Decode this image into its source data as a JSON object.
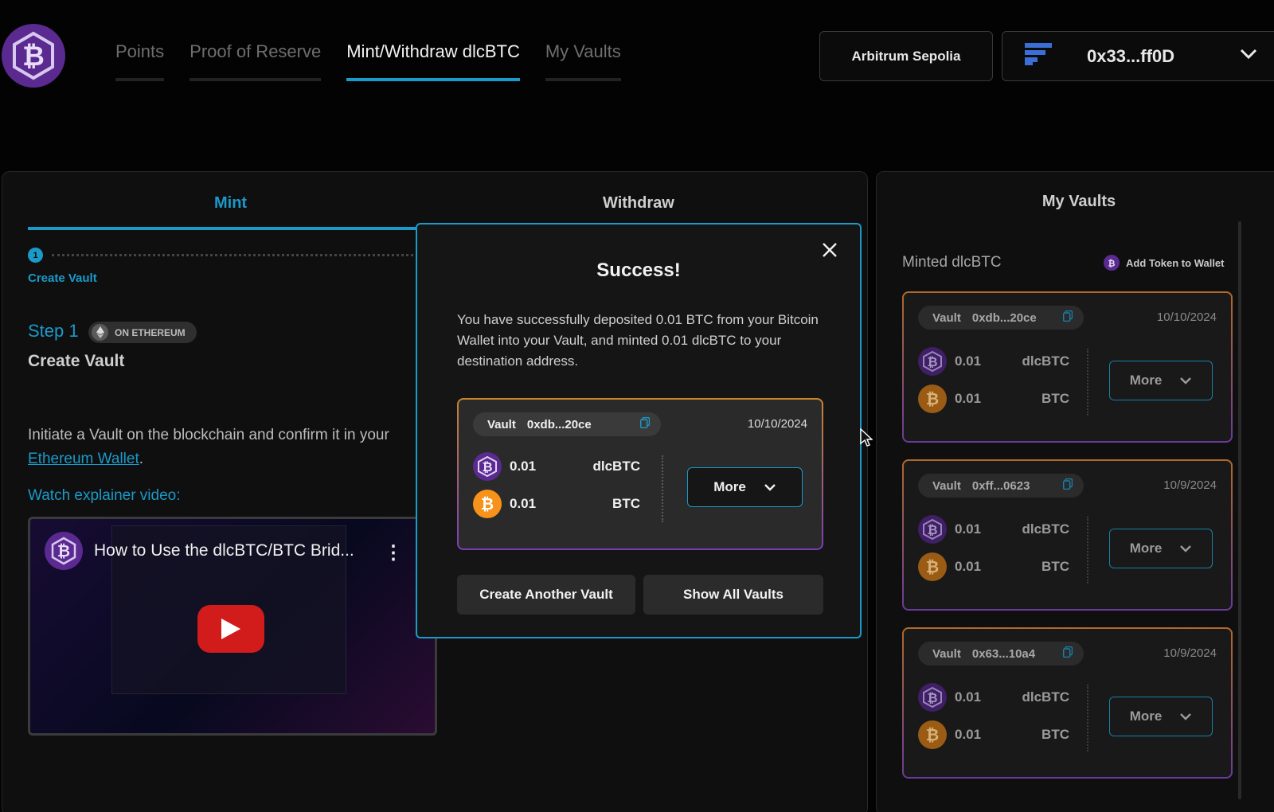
{
  "header": {
    "nav": [
      {
        "label": "Points"
      },
      {
        "label": "Proof of Reserve"
      },
      {
        "label": "Mint/Withdraw dlcBTC"
      },
      {
        "label": "My Vaults"
      }
    ],
    "active_nav": "Mint/Withdraw dlcBTC",
    "network": "Arbitrum Sepolia",
    "wallet_address": "0x33...ff0D"
  },
  "mint_panel": {
    "tabs": {
      "mint": "Mint",
      "withdraw": "Withdraw"
    },
    "stepper": {
      "number": "1",
      "label": "Create Vault"
    },
    "step_title": "Step 1",
    "step_badge": "ON ETHEREUM",
    "heading": "Create Vault",
    "description_prefix": "Initiate a Vault on the blockchain and confirm it in your ",
    "description_link": "Ethereum Wallet",
    "description_suffix": ".",
    "video_label": "Watch explainer video:",
    "video_title": "How to Use the dlcBTC/BTC Brid..."
  },
  "my_vaults": {
    "title": "My Vaults",
    "minted_label": "Minted dlcBTC",
    "add_token": "Add Token to Wallet",
    "vaults": [
      {
        "vault_label": "Vault",
        "id": "0xdb...20ce",
        "date": "10/10/2024",
        "dlc_amount": "0.01",
        "dlc_symbol": "dlcBTC",
        "btc_amount": "0.01",
        "btc_symbol": "BTC",
        "more": "More"
      },
      {
        "vault_label": "Vault",
        "id": "0xff...0623",
        "date": "10/9/2024",
        "dlc_amount": "0.01",
        "dlc_symbol": "dlcBTC",
        "btc_amount": "0.01",
        "btc_symbol": "BTC",
        "more": "More"
      },
      {
        "vault_label": "Vault",
        "id": "0x63...10a4",
        "date": "10/9/2024",
        "dlc_amount": "0.01",
        "dlc_symbol": "dlcBTC",
        "btc_amount": "0.01",
        "btc_symbol": "BTC",
        "more": "More"
      }
    ]
  },
  "modal": {
    "title": "Success!",
    "description": "You have successfully deposited 0.01 BTC from your Bitcoin Wallet into your Vault, and minted 0.01 dlcBTC to your destination address.",
    "vault": {
      "vault_label": "Vault",
      "id": "0xdb...20ce",
      "date": "10/10/2024",
      "dlc_amount": "0.01",
      "dlc_symbol": "dlcBTC",
      "btc_amount": "0.01",
      "btc_symbol": "BTC",
      "more": "More"
    },
    "create_another": "Create Another Vault",
    "show_all": "Show All Vaults"
  },
  "colors": {
    "accent": "#1a9ac9",
    "purple": "#5b2a91",
    "bitcoin": "#f7931a",
    "background": "#030303"
  },
  "icons": [
    "logo-icon",
    "chevron-down-icon",
    "wallet-provider-icon",
    "ethereum-icon",
    "copy-icon",
    "dlcbtc-icon",
    "bitcoin-icon",
    "close-icon",
    "play-icon",
    "more-vertical-icon",
    "cursor-icon"
  ]
}
